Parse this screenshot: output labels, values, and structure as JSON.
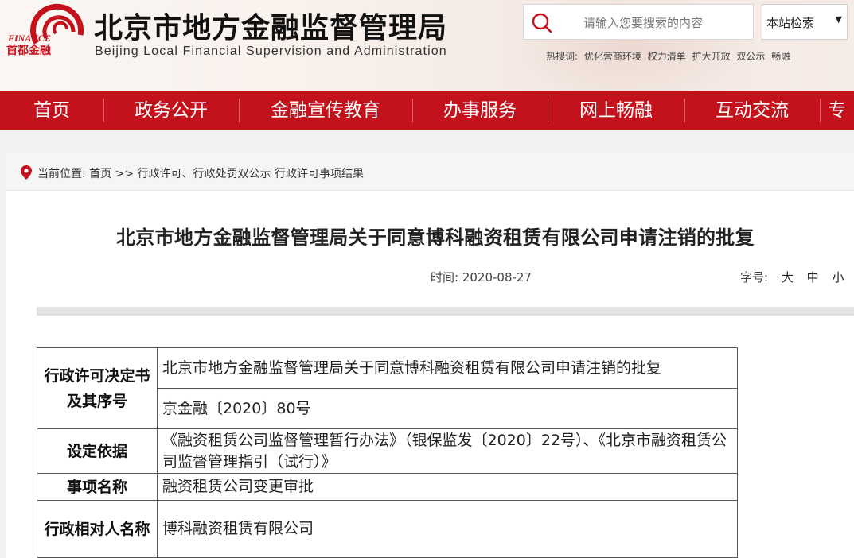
{
  "header": {
    "logo": {
      "brand_en": "FINANCE",
      "brand_cn": "首都金融"
    },
    "site_title": "北京市地方金融监督管理局",
    "site_subtitle": "Beijing Local Financial Supervision and Administration"
  },
  "search": {
    "placeholder": "请输入您要搜索的内容",
    "scope_value": "本站检索"
  },
  "hot_search": {
    "label": "热搜词:",
    "terms": [
      "优化营商环境",
      "权力清单",
      "扩大开放",
      "双公示",
      "畅融"
    ]
  },
  "nav": {
    "items": [
      "首页",
      "政务公开",
      "金融宣传教育",
      "办事服务",
      "网上畅融",
      "互动交流",
      "专"
    ]
  },
  "breadcrumb": {
    "label": "当前位置:",
    "home": "首页",
    "sep": ">>",
    "section": "行政许可、行政处罚双公示",
    "subsection": "行政许可事项结果"
  },
  "article": {
    "title": "北京市地方金融监督管理局关于同意博科融资租赁有限公司申请注销的批复",
    "date_label": "时间:",
    "date": "2020-08-27",
    "font_size_label": "字号:",
    "font_sizes": [
      "大",
      "中",
      "小"
    ]
  },
  "table": {
    "decision_label_line1": "行政许可决定书",
    "decision_label_line2": "及其序号",
    "decision_title": "北京市地方金融监督管理局关于同意博科融资租赁有限公司申请注销的批复",
    "decision_number": "京金融〔2020〕80号",
    "basis_label": "设定依据",
    "basis_value": "《融资租赁公司监督管理暂行办法》（银保监发〔2020〕22号）、《北京市融资租赁公司监督管理指引（试行）》",
    "item_label": "事项名称",
    "item_value": "融资租赁公司变更审批",
    "party_label": "行政相对人名称",
    "party_value": "博科融资租赁有限公司"
  },
  "colors": {
    "nav_bg": "#c4121c",
    "logo_red": "#c4121c"
  },
  "icons": {
    "search": "search-icon",
    "location": "location-pin-icon",
    "dropdown": "chevron-down-icon"
  }
}
